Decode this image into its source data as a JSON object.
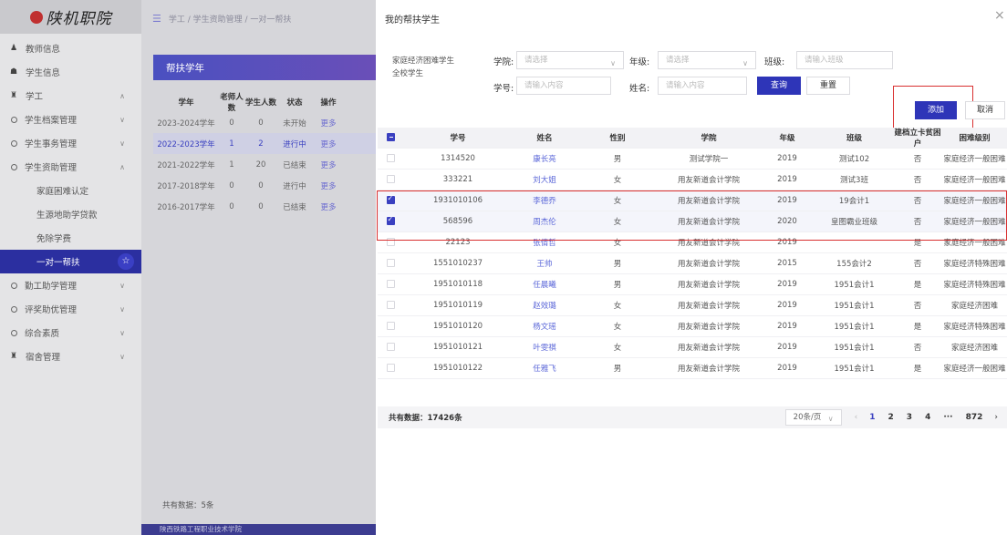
{
  "sidebar": {
    "logo_text": "陕机职院",
    "items": [
      {
        "label": "教师信息",
        "icon": "user-icon",
        "type": "top"
      },
      {
        "label": "学生信息",
        "icon": "student-icon",
        "type": "top"
      },
      {
        "label": "学工",
        "icon": "graduation-icon",
        "type": "top",
        "expanded": true
      },
      {
        "label": "学生档案管理",
        "type": "group"
      },
      {
        "label": "学生事务管理",
        "type": "group"
      },
      {
        "label": "学生资助管理",
        "type": "group",
        "expanded": true
      },
      {
        "label": "家庭困难认定",
        "type": "sub"
      },
      {
        "label": "生源地助学贷款",
        "type": "sub"
      },
      {
        "label": "免除学费",
        "type": "sub"
      },
      {
        "label": "一对一帮扶",
        "type": "sub",
        "active": true
      },
      {
        "label": "勤工助学管理",
        "type": "group"
      },
      {
        "label": "评奖助优管理",
        "type": "group"
      },
      {
        "label": "综合素质",
        "type": "group"
      },
      {
        "label": "宿舍管理",
        "icon": "dorm-icon",
        "type": "top"
      }
    ]
  },
  "topbar": {
    "breadcrumb": "学工 / 学生资助管理 / 一对一帮扶"
  },
  "bg_panel": {
    "title": "帮扶学年",
    "headers": [
      "学年",
      "老师人数",
      "学生人数",
      "状态",
      "操作"
    ],
    "rows": [
      [
        "2023-2024学年",
        "0",
        "0",
        "未开始",
        "更多"
      ],
      [
        "2022-2023学年",
        "1",
        "2",
        "进行中",
        "更多"
      ],
      [
        "2021-2022学年",
        "1",
        "20",
        "已结束",
        "更多"
      ],
      [
        "2017-2018学年",
        "0",
        "0",
        "进行中",
        "更多"
      ],
      [
        "2016-2017学年",
        "0",
        "0",
        "已结束",
        "更多"
      ]
    ],
    "total": "共有数据：5条",
    "footer": "陕西铁路工程职业技术学院"
  },
  "dialog": {
    "title": "我的帮扶学生",
    "student_types": [
      "家庭经济困难学生",
      "全校学生"
    ],
    "filters": {
      "college_label": "学院:",
      "college_placeholder": "请选择",
      "grade_label": "年级:",
      "grade_placeholder": "请选择",
      "class_label": "班级:",
      "class_placeholder": "请输入班级",
      "id_label": "学号:",
      "id_placeholder": "请输入内容",
      "name_label": "姓名:",
      "name_placeholder": "请输入内容",
      "search_label": "查询",
      "reset_label": "重置"
    },
    "add_label": "添加",
    "cancel_label": "取消",
    "table": {
      "headers": [
        "学号",
        "姓名",
        "性别",
        "学院",
        "年级",
        "班级",
        "建档立卡贫困户",
        "困难级别"
      ],
      "rows": [
        {
          "checked": false,
          "cells": [
            "1314520",
            "康长亮",
            "男",
            "测试学院一",
            "2019",
            "测试102",
            "否",
            "家庭经济一般困难"
          ]
        },
        {
          "checked": false,
          "cells": [
            "333221",
            "刘大姐",
            "女",
            "用友新道会计学院",
            "2019",
            "测试3班",
            "否",
            "家庭经济一般困难"
          ]
        },
        {
          "checked": true,
          "cells": [
            "1931010106",
            "李德乔",
            "女",
            "用友新道会计学院",
            "2019",
            "19会计1",
            "否",
            "家庭经济一般困难"
          ]
        },
        {
          "checked": true,
          "cells": [
            "568596",
            "周杰伦",
            "女",
            "用友新道会计学院",
            "2020",
            "皇图霸业班级",
            "否",
            "家庭经济一般困难"
          ]
        },
        {
          "checked": false,
          "cells": [
            "22123",
            "张倩哲",
            "女",
            "用友新道会计学院",
            "2019",
            "",
            "是",
            "家庭经济一般困难"
          ]
        },
        {
          "checked": false,
          "cells": [
            "1551010237",
            "王帅",
            "男",
            "用友新道会计学院",
            "2015",
            "155会计2",
            "否",
            "家庭经济特殊困难"
          ]
        },
        {
          "checked": false,
          "cells": [
            "1951010118",
            "任晨曦",
            "男",
            "用友新道会计学院",
            "2019",
            "1951会计1",
            "是",
            "家庭经济特殊困难"
          ]
        },
        {
          "checked": false,
          "cells": [
            "1951010119",
            "赵效璐",
            "女",
            "用友新道会计学院",
            "2019",
            "1951会计1",
            "否",
            "家庭经济困难"
          ]
        },
        {
          "checked": false,
          "cells": [
            "1951010120",
            "杨文瑶",
            "女",
            "用友新道会计学院",
            "2019",
            "1951会计1",
            "是",
            "家庭经济特殊困难"
          ]
        },
        {
          "checked": false,
          "cells": [
            "1951010121",
            "叶雯祺",
            "女",
            "用友新道会计学院",
            "2019",
            "1951会计1",
            "否",
            "家庭经济困难"
          ]
        },
        {
          "checked": false,
          "cells": [
            "1951010122",
            "任雅飞",
            "男",
            "用友新道会计学院",
            "2019",
            "1951会计1",
            "是",
            "家庭经济一般困难"
          ]
        }
      ]
    },
    "total": "共有数据：17426条",
    "pager": {
      "page_size": "20条/页",
      "pages": [
        "1",
        "2",
        "3",
        "4",
        "···",
        "872"
      ],
      "current": "1"
    }
  },
  "colors": {
    "primary": "#2e35b8",
    "highlight": "#d93030",
    "sidebar_active": "#2b2fa0"
  }
}
